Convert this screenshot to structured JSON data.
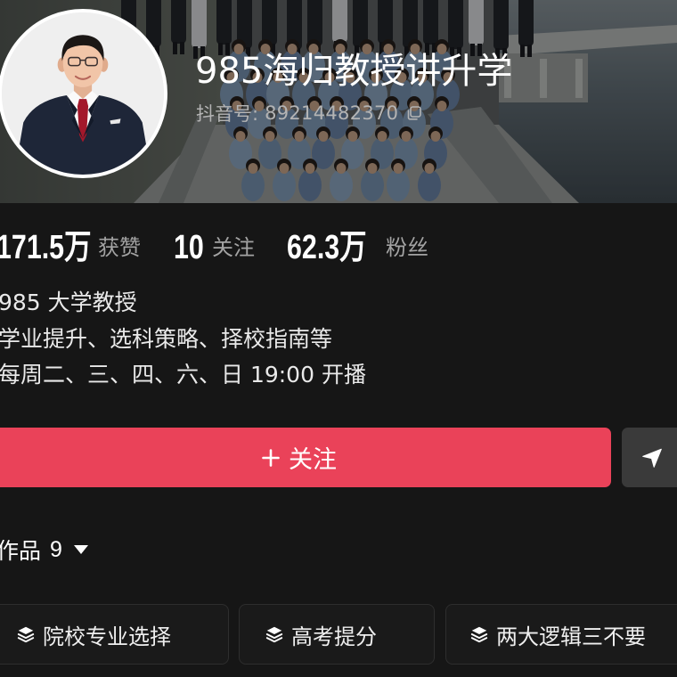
{
  "profile": {
    "nickname": "985海归教授讲升学",
    "id_label": "抖音号:",
    "id_value": "89214482370",
    "copy_icon": "copy-icon"
  },
  "stats": {
    "likes": {
      "value": "171.5万",
      "label": "获赞"
    },
    "following": {
      "value": "10",
      "label": "关注"
    },
    "fans": {
      "value": "62.3万",
      "label": "粉丝"
    }
  },
  "bio": [
    "985 大学教授",
    "学业提升、选科策略、择校指南等",
    "每周二、三、四、六、日 19:00 开播"
  ],
  "actions": {
    "follow_label": "关注",
    "follow_icon": "plus-icon",
    "message_icon": "send-icon"
  },
  "works_tab": {
    "label": "作品",
    "count": "9",
    "dropdown_icon": "caret-down-icon"
  },
  "collections": [
    {
      "label": "院校专业选择",
      "icon": "layers-icon"
    },
    {
      "label": "高考提分",
      "icon": "layers-icon"
    },
    {
      "label": "两大逻辑三不要",
      "icon": "layers-icon"
    }
  ],
  "colors": {
    "background": "#161616",
    "accent": "#EA4259",
    "secondary_button": "#3A3A3A",
    "chip_background": "#1A1A1A",
    "muted_text": "#A3A3A3"
  }
}
